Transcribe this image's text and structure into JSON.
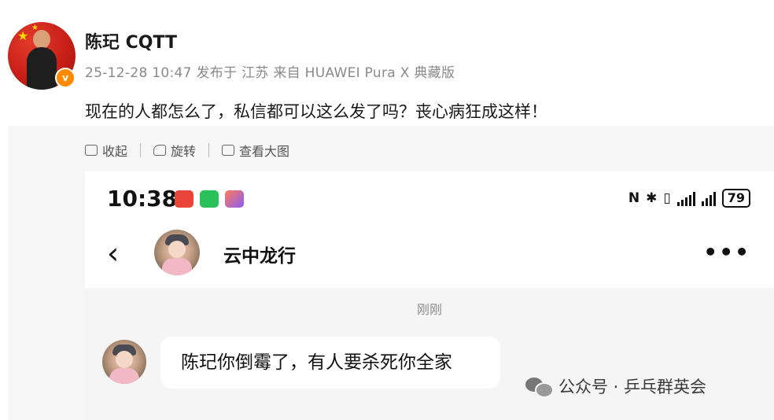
{
  "post": {
    "author": "陈玘 CQTT",
    "meta": "25-12-28 10:47 发布于 江苏 来自 HUAWEI Pura X 典藏版",
    "text": "现在的人都怎么了，私信都可以这么发了吗？丧心病狂成这样！",
    "verify_badge": "v"
  },
  "image_toolbar": {
    "collapse_label": "收起",
    "rotate_label": "旋转",
    "view_large_label": "查看大图"
  },
  "phone": {
    "status_time": "10:38",
    "battery": "79",
    "status_icons": [
      "nfc-icon",
      "bluetooth-icon",
      "vibrate-icon",
      "wifi-signal-icon",
      "cell-signal-icon"
    ],
    "chat": {
      "back_glyph": "‹",
      "contact_name": "云中龙行",
      "more_glyph": "•••",
      "timestamp": "刚刚",
      "message": "陈玘你倒霉了，有人要杀死你全家"
    }
  },
  "watermark": {
    "text": "公众号 · 乒乓群英会"
  },
  "colors": {
    "badge": "#ff8a00",
    "meta_gray": "#8a8a8a",
    "panel_bg": "#f6f6f6",
    "chat_bg": "#f5f5f5"
  }
}
